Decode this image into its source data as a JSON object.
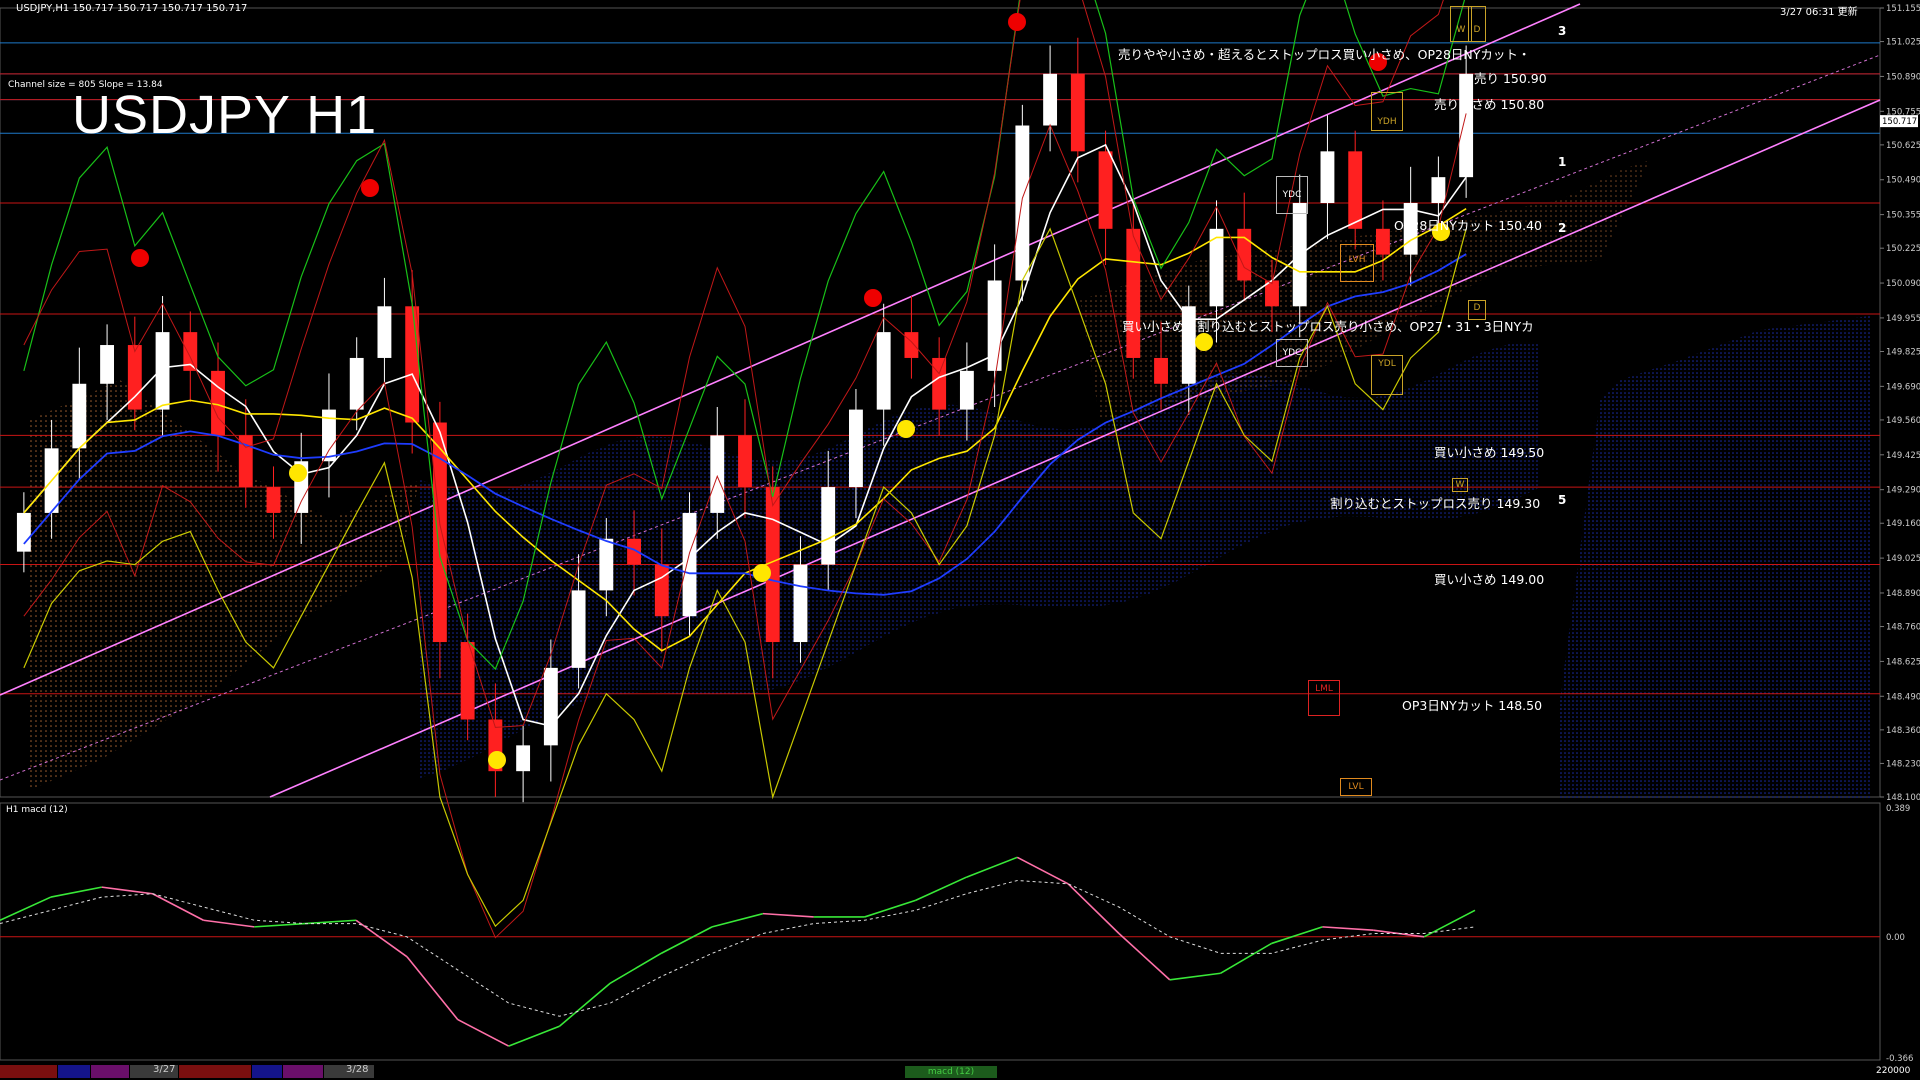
{
  "header": {
    "symbol_info": "USDJPY,H1  150.717 150.717 150.717 150.717",
    "update_time": "3/27 06:31 更新"
  },
  "chart_title": "USDJPY H1",
  "channel_info": "Channel size = 805 Slope = 13.84",
  "colors": {
    "background": "#000000",
    "bull_candle": "#ffffff",
    "bear_candle": "#ff2020",
    "level_line": "#c81414",
    "blue_level": "#1e78c8",
    "channel": "#ff80ff",
    "ma_white": "#ffffff",
    "ma_yellow": "#ffe600",
    "ma_blue": "#1e3cff",
    "chikou": "#18c018",
    "cloud_span": "#c8c800",
    "macd_up": "#38e838",
    "macd_down": "#ff70a8",
    "signal": "#dddddd"
  },
  "annotations": [
    {
      "id": "a1",
      "text": "売りやや小さめ・超えるとストップロス買い小さめ、OP28日NYカット・"
    },
    {
      "id": "a2",
      "text": "売り 150.90"
    },
    {
      "id": "a3",
      "text": "売り小さめ 150.80"
    },
    {
      "id": "a4",
      "text": "OP28日NYカット 150.40"
    },
    {
      "id": "a5",
      "text": "買い小さめ・割り込むとストップロス売り小さめ、OP27・31・3日NYカ"
    },
    {
      "id": "a6",
      "text": "買い小さめ 149.50"
    },
    {
      "id": "a7",
      "text": "割り込むとストップロス売り 149.30"
    },
    {
      "id": "a8",
      "text": "買い小さめ 149.00"
    },
    {
      "id": "a9",
      "text": "OP3日NYカット 148.50"
    }
  ],
  "markers": {
    "n1": "1",
    "n2": "2",
    "n3": "3",
    "n5": "5"
  },
  "boxes": {
    "ydh": "YDH",
    "ydc1": "YDC",
    "ydc2": "YDC",
    "ydl": "YDL",
    "lvh": "LVH",
    "lml": "LML",
    "lvl": "LVL",
    "w": "W",
    "d": "D",
    "d2": "D",
    "wv": "W"
  },
  "macd": {
    "label": "H1  macd (12)",
    "ticks": [
      "0.389",
      "0.00",
      "-0.366"
    ]
  },
  "bottom": {
    "dates": [
      "3/27",
      "3/28"
    ],
    "tab": "macd (12)",
    "right": "220000"
  },
  "chart_data": [
    {
      "type": "candlestick",
      "title": "USDJPY H1",
      "ylim": [
        148.1,
        151.155
      ],
      "y_ticks": [
        "151.155",
        "151.025",
        "150.890",
        "150.755",
        "150.625",
        "150.490",
        "150.355",
        "150.225",
        "150.090",
        "149.955",
        "149.825",
        "149.690",
        "149.560",
        "149.425",
        "149.290",
        "149.160",
        "149.025",
        "148.890",
        "148.760",
        "148.625",
        "148.490",
        "148.360",
        "148.230",
        "148.100"
      ],
      "current_price": "150.717",
      "levels": [
        150.9,
        150.8,
        150.4,
        149.5,
        149.3,
        149.0,
        148.5
      ],
      "series": [
        {
          "name": "close",
          "values": [
            149.2,
            149.45,
            149.7,
            149.85,
            149.6,
            149.9,
            149.75,
            149.5,
            149.3,
            149.2,
            149.4,
            149.6,
            149.8,
            150.0,
            149.55,
            148.7,
            148.4,
            148.2,
            148.3,
            148.6,
            148.9,
            149.1,
            149.0,
            148.8,
            149.2,
            149.5,
            149.3,
            148.7,
            149.0,
            149.3,
            149.6,
            149.9,
            149.8,
            149.6,
            149.75,
            150.1,
            150.7,
            150.9,
            150.6,
            150.3,
            149.8,
            149.7,
            150.0,
            150.3,
            150.1,
            150.0,
            150.4,
            150.6,
            150.3,
            150.2,
            150.4,
            150.5,
            150.9
          ]
        }
      ]
    },
    {
      "type": "line",
      "title": "H1  macd (12)",
      "ylim": [
        -0.366,
        0.389
      ],
      "series": [
        {
          "name": "macd",
          "values": [
            0.05,
            0.12,
            0.15,
            0.13,
            0.05,
            0.03,
            0.04,
            0.05,
            -0.06,
            -0.25,
            -0.33,
            -0.27,
            -0.14,
            -0.05,
            0.03,
            0.07,
            0.06,
            0.06,
            0.11,
            0.18,
            0.24,
            0.16,
            0.01,
            -0.13,
            -0.11,
            -0.02,
            0.03,
            0.02,
            0.0,
            0.08
          ]
        },
        {
          "name": "signal",
          "values": [
            0.04,
            0.08,
            0.12,
            0.13,
            0.09,
            0.05,
            0.04,
            0.04,
            0.0,
            -0.1,
            -0.2,
            -0.24,
            -0.2,
            -0.12,
            -0.05,
            0.01,
            0.04,
            0.05,
            0.08,
            0.13,
            0.17,
            0.16,
            0.09,
            0.0,
            -0.05,
            -0.05,
            -0.01,
            0.01,
            0.01,
            0.03
          ]
        }
      ]
    }
  ]
}
